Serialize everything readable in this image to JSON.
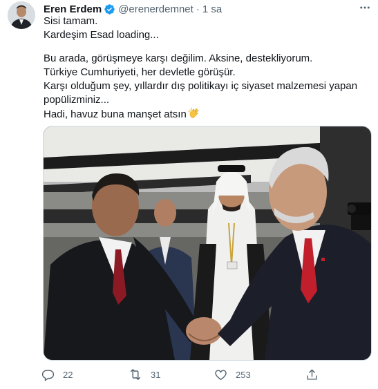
{
  "tweet": {
    "author_name": "Eren Erdem",
    "handle": "@erenerdemnet",
    "separator": "·",
    "time": "1 sa",
    "text_lines": [
      "Sisi tamam.",
      "Kardeşim Esad loading...",
      "",
      "Bu arada, görüşmeye karşı değilim. Aksine, destekliyorum.",
      "Türkiye Cumhuriyeti, her devletle görüşür.",
      "Karşı olduğum şey, yıllardır dış politikayı iç siyaset malzemesi yapan",
      "popülizminiz...",
      "Hadi, havuz buna manşet atsın"
    ]
  },
  "actions": {
    "replies": "22",
    "retweets": "31",
    "likes": "253"
  },
  "icons": {
    "verified": "verified-badge-icon",
    "more": "more-options-icon",
    "reply": "reply-icon",
    "retweet": "retweet-icon",
    "like": "like-icon",
    "share": "share-icon",
    "emoji": "clapping-hands-emoji"
  },
  "colors": {
    "text": "#0f1419",
    "secondary": "#536471",
    "verified": "#1d9bf0",
    "border": "#cfd9de"
  }
}
